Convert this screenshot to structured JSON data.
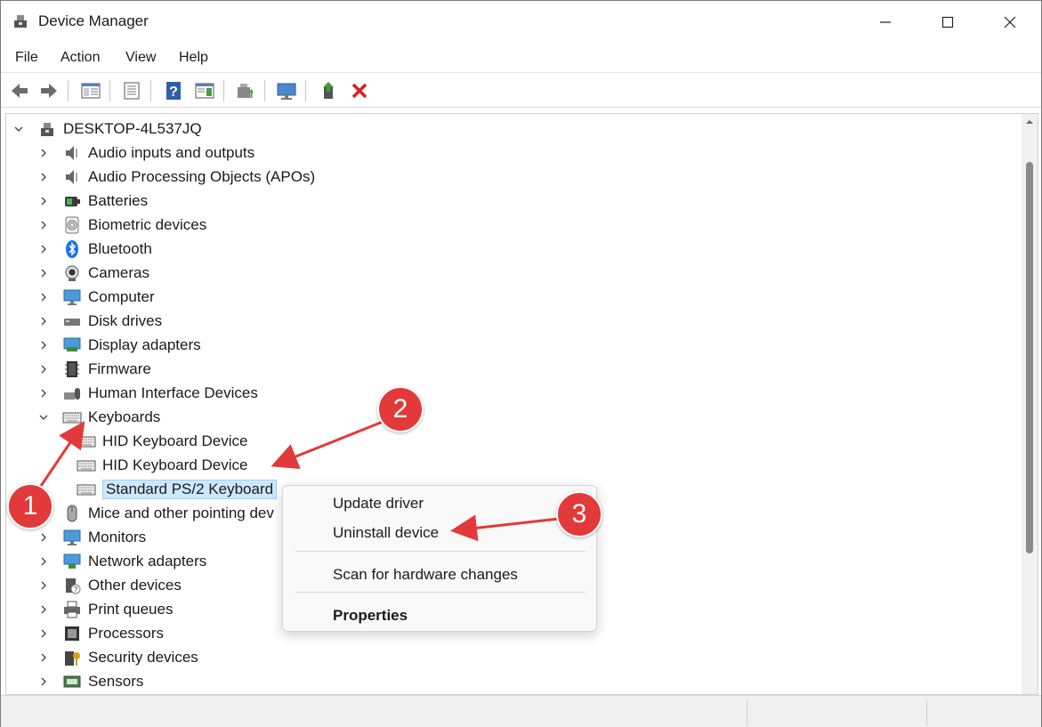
{
  "window": {
    "title": "Device Manager"
  },
  "menu": [
    "File",
    "Action",
    "View",
    "Help"
  ],
  "tree": {
    "root": "DESKTOP-4L537JQ",
    "categories": [
      {
        "label": "Audio inputs and outputs",
        "icon": "speaker-icon"
      },
      {
        "label": "Audio Processing Objects (APOs)",
        "icon": "speaker-icon"
      },
      {
        "label": "Batteries",
        "icon": "battery-icon"
      },
      {
        "label": "Biometric devices",
        "icon": "fingerprint-icon"
      },
      {
        "label": "Bluetooth",
        "icon": "bluetooth-icon"
      },
      {
        "label": "Cameras",
        "icon": "camera-icon"
      },
      {
        "label": "Computer",
        "icon": "monitor-icon"
      },
      {
        "label": "Disk drives",
        "icon": "disk-icon"
      },
      {
        "label": "Display adapters",
        "icon": "display-adapter-icon"
      },
      {
        "label": "Firmware",
        "icon": "chip-icon"
      },
      {
        "label": "Human Interface Devices",
        "icon": "hid-icon"
      },
      {
        "label": "Keyboards",
        "icon": "keyboard-icon"
      },
      {
        "label": "HID Keyboard Device",
        "icon": "keyboard-icon"
      },
      {
        "label": "HID Keyboard Device",
        "icon": "keyboard-icon"
      },
      {
        "label": "Standard PS/2 Keyboard",
        "icon": "keyboard-icon"
      },
      {
        "label": "Mice and other pointing dev",
        "icon": "mouse-icon"
      },
      {
        "label": "Monitors",
        "icon": "monitor-icon"
      },
      {
        "label": "Network adapters",
        "icon": "network-icon"
      },
      {
        "label": "Other devices",
        "icon": "other-device-icon"
      },
      {
        "label": "Print queues",
        "icon": "printer-icon"
      },
      {
        "label": "Processors",
        "icon": "processor-icon"
      },
      {
        "label": "Security devices",
        "icon": "security-icon"
      },
      {
        "label": "Sensors",
        "icon": "sensor-icon"
      }
    ]
  },
  "context_menu": {
    "items": [
      "Update driver",
      "Uninstall device",
      "Scan for hardware changes",
      "Properties"
    ]
  },
  "annotations": [
    "1",
    "2",
    "3"
  ],
  "colors": {
    "selection": "#cce8ff",
    "annotation": "#e23a3a"
  }
}
